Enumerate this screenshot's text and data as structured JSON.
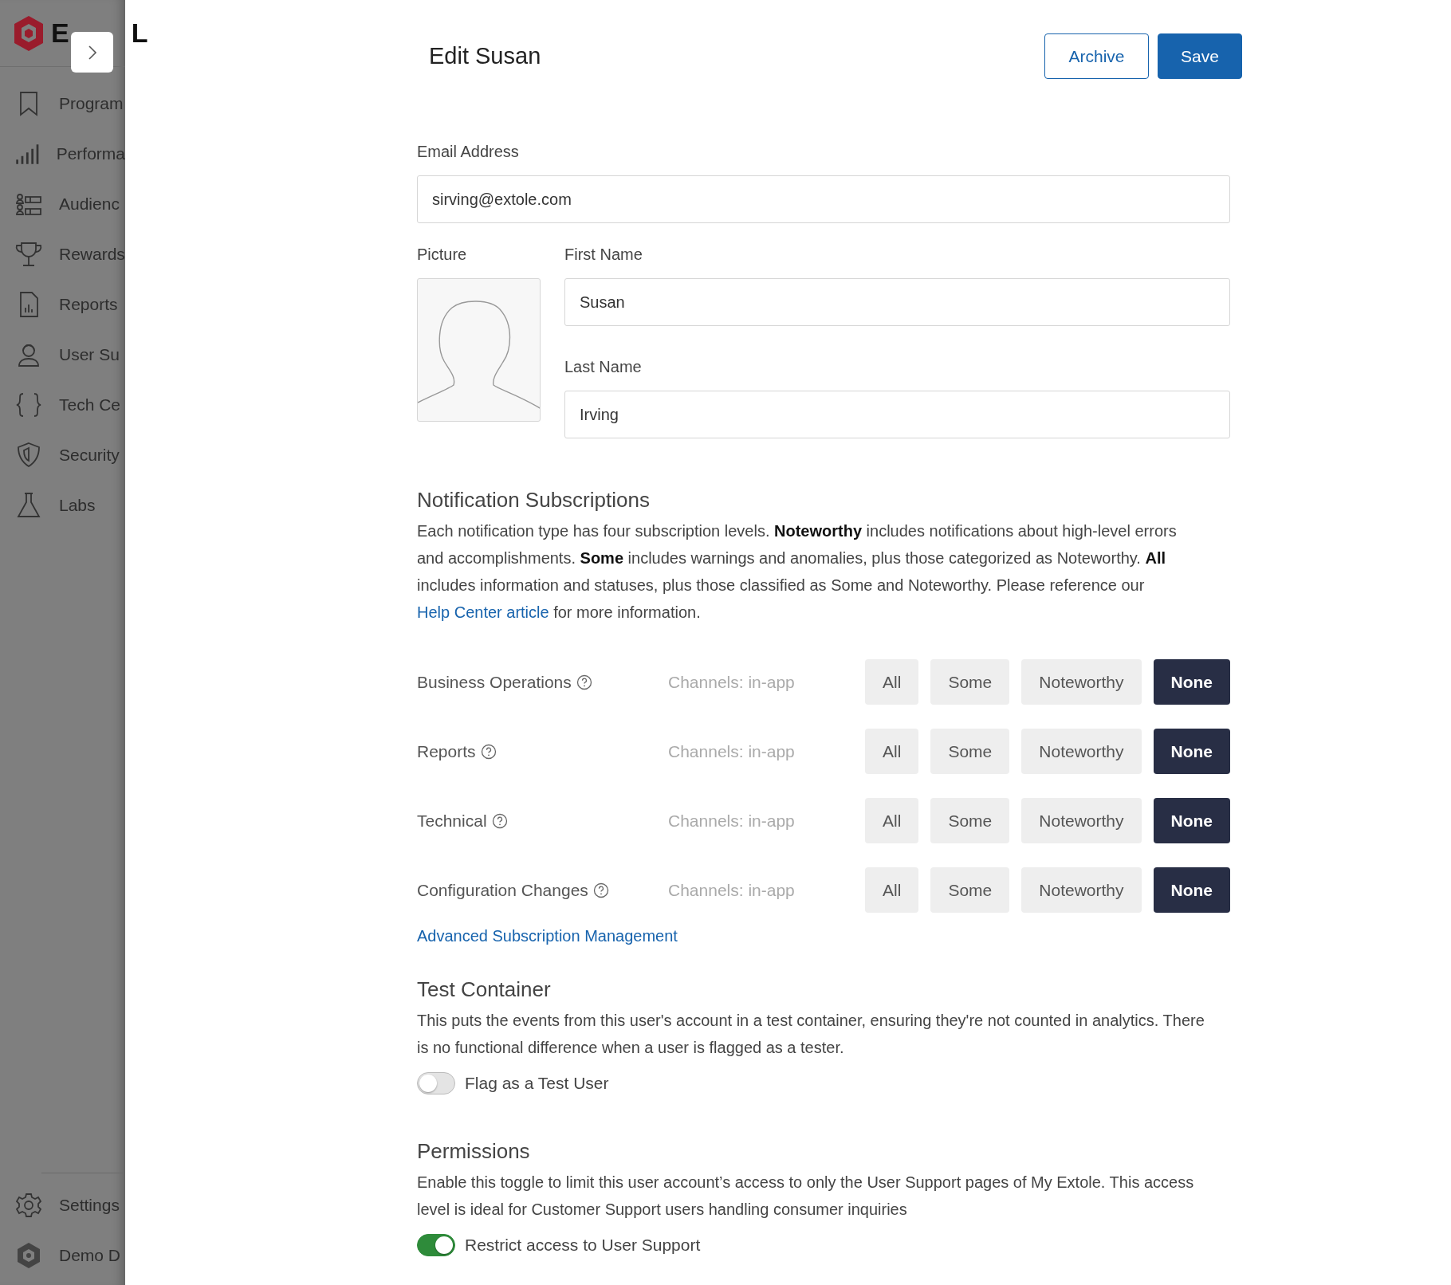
{
  "sidebar": {
    "logo_text_parts": [
      "E",
      "L"
    ],
    "items": [
      {
        "label": "Program"
      },
      {
        "label": "Performa"
      },
      {
        "label": "Audienc"
      },
      {
        "label": "Rewards"
      },
      {
        "label": "Reports"
      },
      {
        "label": "User Su"
      },
      {
        "label": "Tech Ce"
      },
      {
        "label": "Security"
      },
      {
        "label": "Labs"
      }
    ],
    "footer_items": [
      {
        "label": "Settings"
      },
      {
        "label": "Demo D"
      }
    ]
  },
  "header": {
    "title": "Edit Susan",
    "buttons": [
      {
        "label": "Archive",
        "kind": "outline"
      },
      {
        "label": "Save",
        "kind": "primary"
      }
    ]
  },
  "form": {
    "email": {
      "label": "Email Address",
      "value": "sirving@extole.com"
    },
    "picture": {
      "label": "Picture"
    },
    "first_name": {
      "label": "First Name",
      "value": "Susan"
    },
    "last_name": {
      "label": "Last Name",
      "value": "Irving"
    }
  },
  "notifications": {
    "heading": "Notification Subscriptions",
    "description": "Each notification type has four subscription levels. **Noteworthy** includes notifications about high-level errors and accomplishments. **Some** includes warnings and anomalies, plus those categorized as Noteworthy. **All** includes information and statuses, plus those classified as Some and Noteworthy. Please reference our",
    "link": "Help Center article",
    "description_end": "for more information.",
    "rows": [
      {
        "name": "Business Operations",
        "channels": "Channels: in-app",
        "options": [
          {
            "label": "All",
            "selected": false
          },
          {
            "label": "Some",
            "selected": false
          },
          {
            "label": "Noteworthy",
            "selected": false
          },
          {
            "label": "None",
            "selected": true
          }
        ]
      },
      {
        "name": "Reports",
        "channels": "Channels: in-app",
        "options": [
          {
            "label": "All",
            "selected": false
          },
          {
            "label": "Some",
            "selected": false
          },
          {
            "label": "Noteworthy",
            "selected": false
          },
          {
            "label": "None",
            "selected": true
          }
        ]
      },
      {
        "name": "Technical",
        "channels": "Channels: in-app",
        "options": [
          {
            "label": "All",
            "selected": false
          },
          {
            "label": "Some",
            "selected": false
          },
          {
            "label": "Noteworthy",
            "selected": false
          },
          {
            "label": "None",
            "selected": true
          }
        ]
      },
      {
        "name": "Configuration Changes",
        "channels": "Channels: in-app",
        "options": [
          {
            "label": "All",
            "selected": false
          },
          {
            "label": "Some",
            "selected": false
          },
          {
            "label": "Noteworthy",
            "selected": false
          },
          {
            "label": "None",
            "selected": true
          }
        ]
      }
    ],
    "advanced_link": "Advanced Subscription Management"
  },
  "test_container": {
    "heading": "Test Container",
    "description": "This puts the events from this user's account in a test container, ensuring they're not counted in analytics. There is no functional difference when a user is flagged as a tester.",
    "toggle": {
      "label": "Flag as a Test User",
      "on": false
    }
  },
  "permissions": {
    "heading": "Permissions",
    "description": "Enable this toggle to limit this user account’s access to only the User Support pages of My Extole. This access level is ideal for Customer Support users handling consumer inquiries",
    "toggle": {
      "label": "Restrict access to User Support",
      "on": true
    }
  }
}
